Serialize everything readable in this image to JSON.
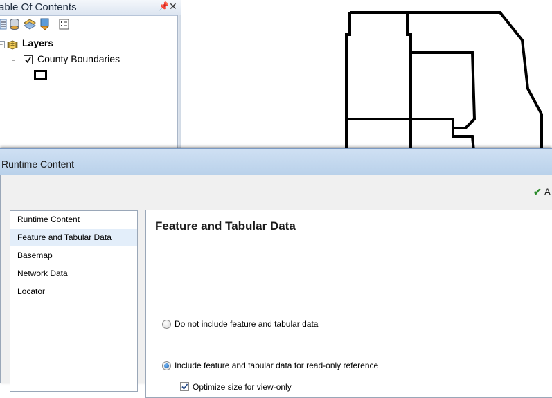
{
  "toc": {
    "title": "able Of Contents",
    "pin_glyph": "⌂",
    "close_glyph": "✕",
    "toolbar_icons": [
      "list-by-drawing-order-icon",
      "list-by-source-icon",
      "list-by-visibility-icon",
      "list-by-selection-icon",
      "options-icon"
    ],
    "layers_label": "Layers",
    "layer_name": "County Boundaries",
    "layer_checked": true
  },
  "dialog": {
    "title": "Runtime Content",
    "accept_label": "A",
    "nav_items": [
      {
        "label": "Runtime Content",
        "selected": false
      },
      {
        "label": "Feature and Tabular Data",
        "selected": true
      },
      {
        "label": "Basemap",
        "selected": false
      },
      {
        "label": "Network Data",
        "selected": false
      },
      {
        "label": "Locator",
        "selected": false
      }
    ],
    "section_title": "Feature and Tabular Data",
    "option_exclude": {
      "label": "Do not include feature and tabular data",
      "selected": false
    },
    "option_include": {
      "label": "Include feature and tabular data for read-only reference",
      "selected": true
    },
    "optimize": {
      "label": "Optimize size for view-only",
      "checked": true
    }
  },
  "colors": {
    "selection": "#e3eefa",
    "titlebar": "#b9d1ea",
    "accept_check": "#2a8a2a"
  }
}
